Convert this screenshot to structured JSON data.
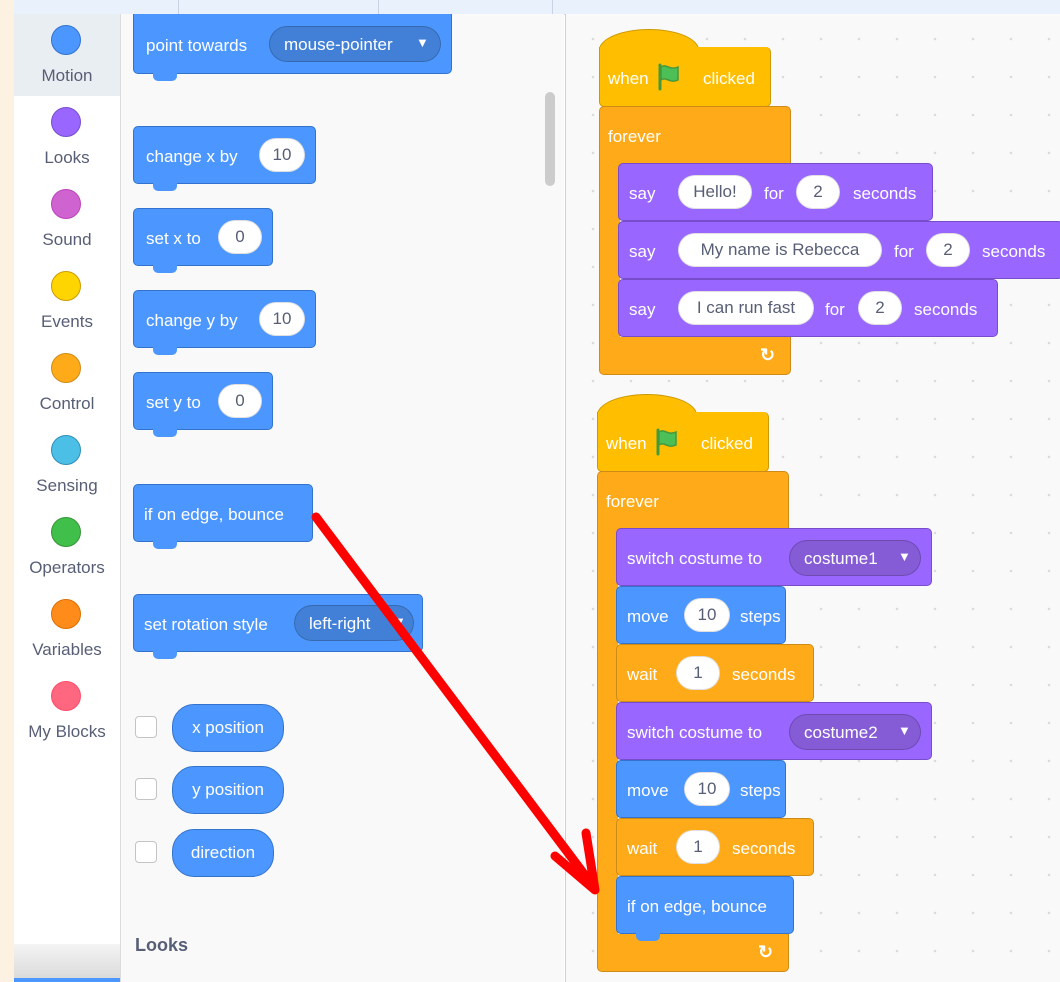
{
  "categories": [
    {
      "label": "Motion",
      "color": "#4c97ff",
      "selected": true
    },
    {
      "label": "Looks",
      "color": "#9966ff"
    },
    {
      "label": "Sound",
      "color": "#cf63cf"
    },
    {
      "label": "Events",
      "color": "#ffd500"
    },
    {
      "label": "Control",
      "color": "#ffab19"
    },
    {
      "label": "Sensing",
      "color": "#4cbfe6"
    },
    {
      "label": "Operators",
      "color": "#40bf4a"
    },
    {
      "label": "Variables",
      "color": "#ff8c1a"
    },
    {
      "label": "My Blocks",
      "color": "#ff6680"
    }
  ],
  "palette": {
    "point_towards": {
      "label": "point towards",
      "value": "mouse-pointer"
    },
    "change_x": {
      "label": "change x by",
      "value": "10"
    },
    "set_x": {
      "label": "set x to",
      "value": "0"
    },
    "change_y": {
      "label": "change y by",
      "value": "10"
    },
    "set_y": {
      "label": "set y to",
      "value": "0"
    },
    "bounce": {
      "label": "if on edge, bounce"
    },
    "rotation": {
      "label": "set rotation style",
      "value": "left-right"
    },
    "reporters": [
      "x position",
      "y position",
      "direction"
    ],
    "looks_header": "Looks"
  },
  "script1": {
    "when": "when",
    "clicked": "clicked",
    "forever": "forever",
    "says": [
      {
        "say": "say",
        "text": "Hello!",
        "for": "for",
        "secs": "2",
        "unit": "seconds"
      },
      {
        "say": "say",
        "text": "My name is Rebecca",
        "for": "for",
        "secs": "2",
        "unit": "seconds"
      },
      {
        "say": "say",
        "text": "I can run fast",
        "for": "for",
        "secs": "2",
        "unit": "seconds"
      }
    ]
  },
  "script2": {
    "when": "when",
    "clicked": "clicked",
    "forever": "forever",
    "costume1": {
      "label": "switch costume to",
      "value": "costume1"
    },
    "move1": {
      "label": "move",
      "value": "10",
      "unit": "steps"
    },
    "wait1": {
      "label": "wait",
      "value": "1",
      "unit": "seconds"
    },
    "costume2": {
      "label": "switch costume to",
      "value": "costume2"
    },
    "move2": {
      "label": "move",
      "value": "10",
      "unit": "steps"
    },
    "wait2": {
      "label": "wait",
      "value": "1",
      "unit": "seconds"
    },
    "bounce": "if on edge, bounce"
  },
  "colors": {
    "motion": "#4c97ff",
    "looks": "#9966ff",
    "control": "#ffab19",
    "events": "#ffbf00",
    "arrow": "#ff0000"
  }
}
